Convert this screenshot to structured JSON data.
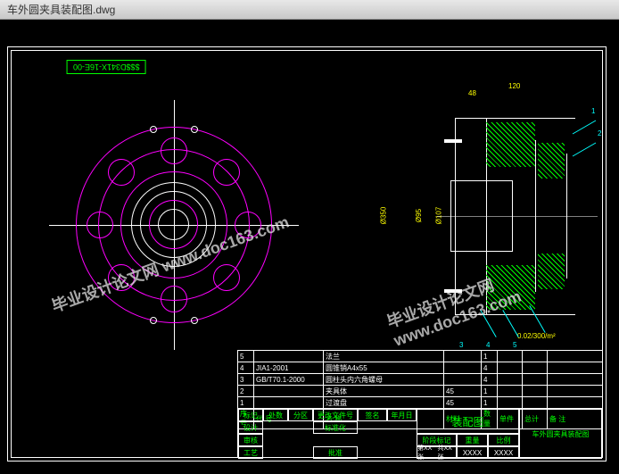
{
  "window": {
    "title": "车外圆夹具装配图.dwg"
  },
  "partno_box": "$$$D341X-16E-00",
  "watermark": "毕业设计论文网\nwww.doc163.com",
  "dimensions": {
    "top1": "48",
    "top2": "120",
    "dia1": "Ø350",
    "dia2": "Ø95",
    "dia3": "Ø107",
    "gd": "0.02/300/m²"
  },
  "balloons": [
    "1",
    "2",
    "3",
    "4",
    "5"
  ],
  "bom": {
    "rows": [
      {
        "no": "5",
        "std": "",
        "name": "法兰",
        "mat": "",
        "qty": "1",
        "note": ""
      },
      {
        "no": "4",
        "std": "JIA1-2001",
        "name": "圆锥销A4x55",
        "mat": "",
        "qty": "4",
        "note": ""
      },
      {
        "no": "3",
        "std": "GB/T70.1-2000",
        "name": "圆柱头内六角螺母",
        "mat": "",
        "qty": "4",
        "note": ""
      },
      {
        "no": "2",
        "std": "",
        "name": "夹具体",
        "mat": "45",
        "qty": "1",
        "note": ""
      },
      {
        "no": "1",
        "std": "",
        "name": "过渡盘",
        "mat": "45",
        "qty": "1",
        "note": ""
      }
    ],
    "headers": {
      "no": "序号",
      "std": "代    号",
      "name": "名                称",
      "qty": "数量",
      "mat": "材料",
      "unit": "单件",
      "total": "总计",
      "wt": "重 量",
      "note": "备 注"
    }
  },
  "titleblock": {
    "main_title": "装配图",
    "drawing_name": "车外圆夹具装配图",
    "rows": {
      "r1": [
        "标记",
        "处数",
        "分区",
        "更改文件号",
        "签名",
        "年月日"
      ],
      "r2": [
        "设计",
        "",
        "",
        "标准化",
        ""
      ],
      "r3": [
        "审核",
        "",
        "",
        "",
        ""
      ],
      "r4": [
        "工艺",
        "",
        "",
        "批准",
        ""
      ]
    },
    "fields": {
      "stage": "阶段标记",
      "weight": "重量",
      "scale": "比例",
      "sheet": "第XX张",
      "total": "共XX张",
      "dept": "XXXX",
      "scale_val": "XXXX"
    }
  }
}
